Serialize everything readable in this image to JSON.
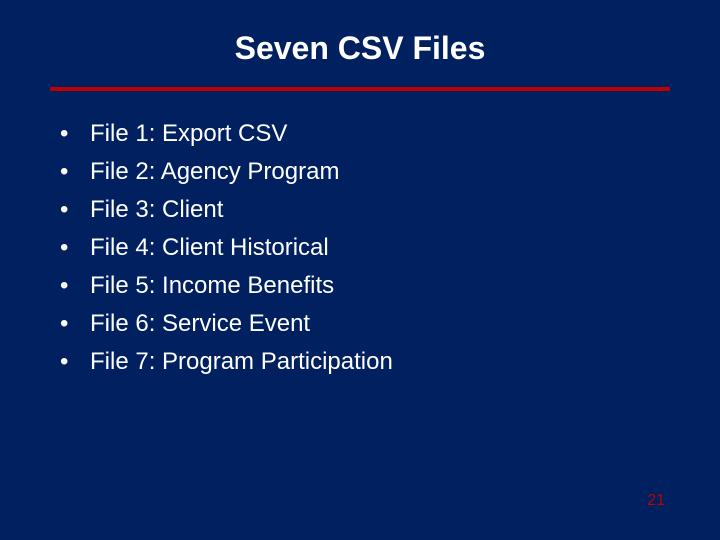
{
  "title": "Seven CSV Files",
  "bullets": {
    "item0": "File 1:  Export CSV",
    "item1": "File 2:  Agency Program",
    "item2": "File 3:  Client",
    "item3": "File 4:  Client Historical",
    "item4": "File 5: Income Benefits",
    "item5": "File 6: Service Event",
    "item6": "File 7: Program Participation"
  },
  "pageNumber": "21"
}
